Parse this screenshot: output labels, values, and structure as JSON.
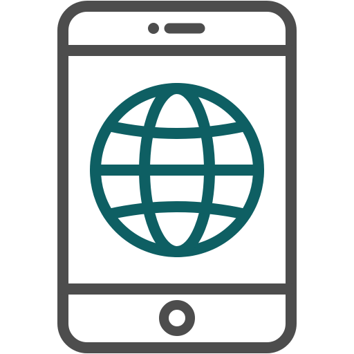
{
  "icon": {
    "name": "smartphone-globe-icon",
    "device": "smartphone-icon",
    "glyph": "globe-icon"
  },
  "colors": {
    "device_stroke": "#4d4d4d",
    "globe_stroke": "#0e5f63",
    "background": "#ffffff"
  }
}
